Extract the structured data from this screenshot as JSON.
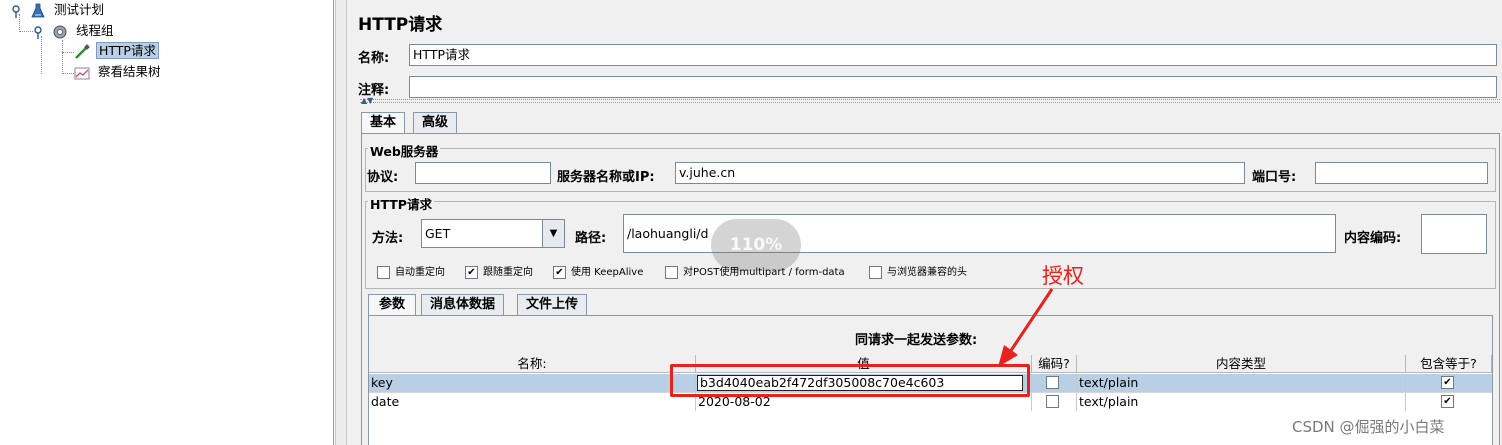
{
  "tree": {
    "items": [
      {
        "label": "测试计划"
      },
      {
        "label": "线程组"
      },
      {
        "label": "HTTP请求"
      },
      {
        "label": "察看结果树"
      }
    ]
  },
  "panel": {
    "title": "HTTP请求",
    "name_label": "名称:",
    "name_value": "HTTP请求",
    "comment_label": "注释:",
    "comment_value": "",
    "tabs": [
      {
        "label": "基本"
      },
      {
        "label": "高级"
      }
    ],
    "web_server": {
      "title": "Web服务器",
      "protocol_label": "协议:",
      "protocol_value": "",
      "server_label": "服务器名称或IP:",
      "server_value": "v.juhe.cn",
      "port_label": "端口号:",
      "port_value": ""
    },
    "http_request": {
      "title": "HTTP请求",
      "method_label": "方法:",
      "method_value": "GET",
      "path_label": "路径:",
      "path_value": "/laohuangli/d",
      "encoding_label": "内容编码:",
      "encoding_value": "",
      "zoom_overlay": "110%",
      "checkboxes": [
        {
          "label": "自动重定向",
          "checked": false
        },
        {
          "label": "跟随重定向",
          "checked": true
        },
        {
          "label": "使用 KeepAlive",
          "checked": true
        },
        {
          "label": "对POST使用multipart / form-data",
          "checked": false
        },
        {
          "label": "与浏览器兼容的头",
          "checked": false
        }
      ]
    },
    "params_tabs": [
      {
        "label": "参数"
      },
      {
        "label": "消息体数据"
      },
      {
        "label": "文件上传"
      }
    ],
    "params": {
      "caption": "同请求一起发送参数:",
      "columns": [
        "名称:",
        "值",
        "编码?",
        "内容类型",
        "包含等于?"
      ],
      "rows": [
        {
          "name": "key",
          "value": "b3d4040eab2f472df305008c70e4c603",
          "encode": false,
          "content_type": "text/plain",
          "include_equals": true
        },
        {
          "name": "date",
          "value": "2020-08-02",
          "encode": false,
          "content_type": "text/plain",
          "include_equals": true
        }
      ]
    }
  },
  "annotation": {
    "label": "授权",
    "color": "#e8221c"
  },
  "watermark": "CSDN @倔强的小白菜",
  "colors": {
    "selection": "#b8cfe5",
    "row_selected": "#b8cfe5",
    "annotation_red": "#e8221c"
  }
}
